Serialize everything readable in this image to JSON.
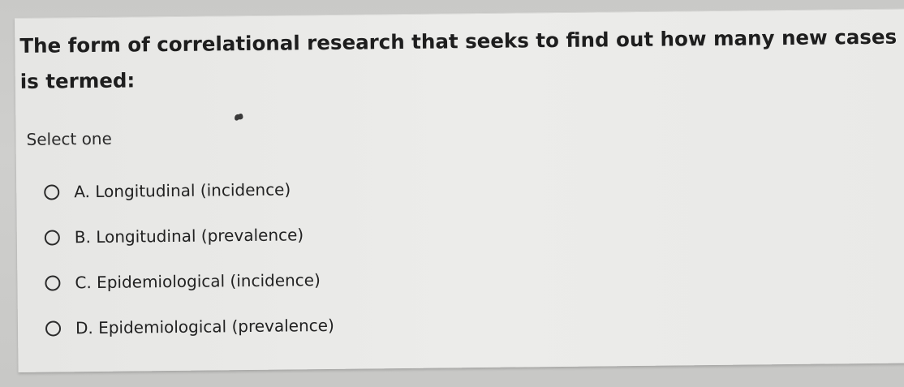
{
  "question": {
    "line1": "The form of correlational research that seeks to find out how many new cases of a diso",
    "line2": "is termed:"
  },
  "prompt": "Select one",
  "options": [
    {
      "letter": "A.",
      "text": "Longitudinal (incidence)"
    },
    {
      "letter": "B.",
      "text": "Longitudinal (prevalence)"
    },
    {
      "letter": "C.",
      "text": "Epidemiological (incidence)"
    },
    {
      "letter": "D.",
      "text": "Epidemiological (prevalence)"
    }
  ],
  "selected": null
}
